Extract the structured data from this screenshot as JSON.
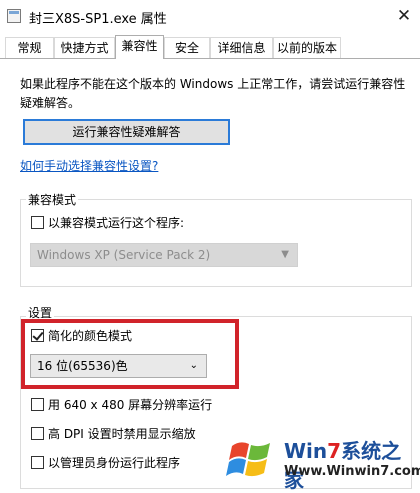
{
  "window": {
    "title": "封三X8S-SP1.exe 属性",
    "close_glyph": "✕"
  },
  "tabs": [
    {
      "label": "常规"
    },
    {
      "label": "快捷方式"
    },
    {
      "label": "兼容性"
    },
    {
      "label": "安全"
    },
    {
      "label": "详细信息"
    },
    {
      "label": "以前的版本"
    }
  ],
  "active_tab": "兼容性",
  "compat": {
    "description": "如果此程序不能在这个版本的 Windows 上正常工作，请尝试运行兼容性疑难解答。",
    "troubleshoot_button": "运行兼容性疑难解答",
    "manual_link": "如何手动选择兼容性设置?"
  },
  "compat_mode": {
    "title": "兼容模式",
    "checkbox_label": "以兼容模式运行这个程序:",
    "checked": false,
    "os_select": "Windows XP (Service Pack 2)"
  },
  "settings": {
    "title": "设置",
    "reduced_color": {
      "label": "简化的颜色模式",
      "checked": true
    },
    "color_select": "16 位(65536)色",
    "res_640": {
      "label": "用 640 x 480 屏幕分辨率运行",
      "checked": false
    },
    "dpi": {
      "label": "高 DPI 设置时禁用显示缩放",
      "checked": false
    },
    "admin": {
      "label": "以管理员身份运行此程序",
      "checked": false
    }
  },
  "watermark": {
    "brand_a": "Win",
    "brand_seven": "7",
    "brand_b": "系统之家",
    "url": "Www.Winwin7.com"
  },
  "colors": {
    "link": "#0a56c2",
    "highlight": "#d1232a",
    "focus_border": "#2b7bd8"
  }
}
